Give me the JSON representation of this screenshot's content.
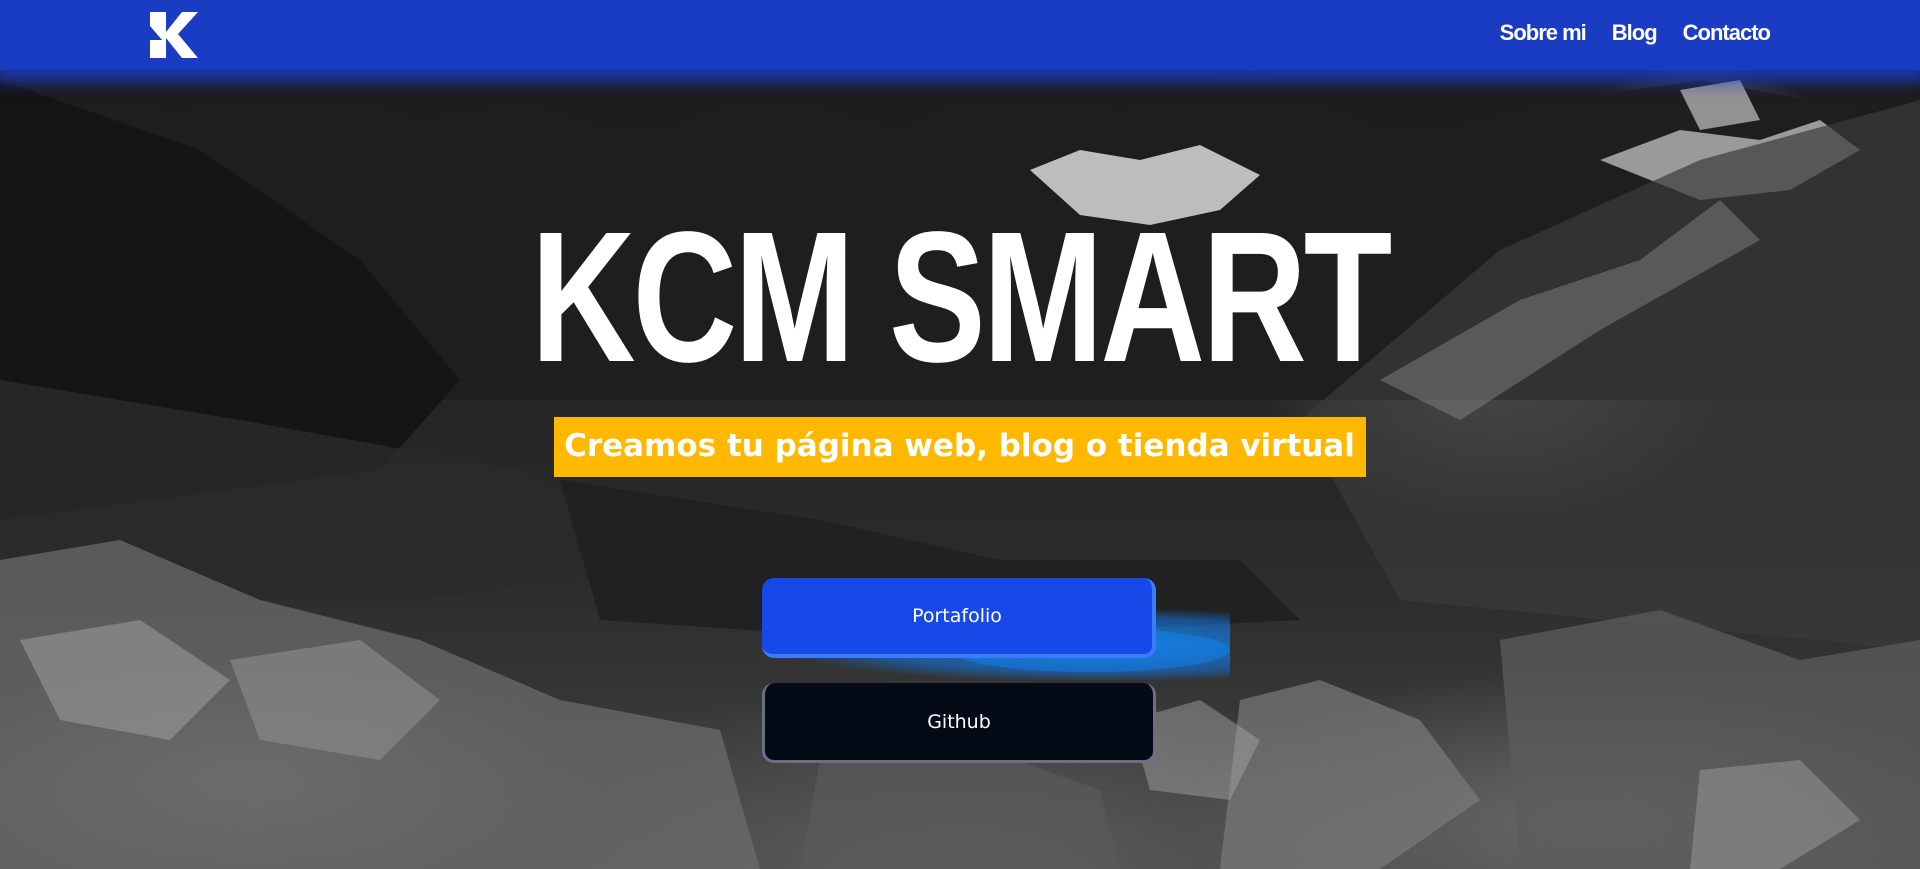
{
  "header": {
    "logo_icon": "ks-monogram-icon",
    "nav": [
      {
        "label": "Sobre mi"
      },
      {
        "label": "Blog"
      },
      {
        "label": "Contacto"
      }
    ]
  },
  "hero": {
    "title": "KCM SMART",
    "tagline": "Creamos tu página web, blog o tienda virtual",
    "buttons": {
      "portfolio": "Portafolio",
      "github": "Github"
    }
  },
  "colors": {
    "header": "#1a3cc2",
    "tagline_bg": "#ffb800",
    "portfolio_btn": "#1748e8",
    "github_btn": "#050a17"
  }
}
